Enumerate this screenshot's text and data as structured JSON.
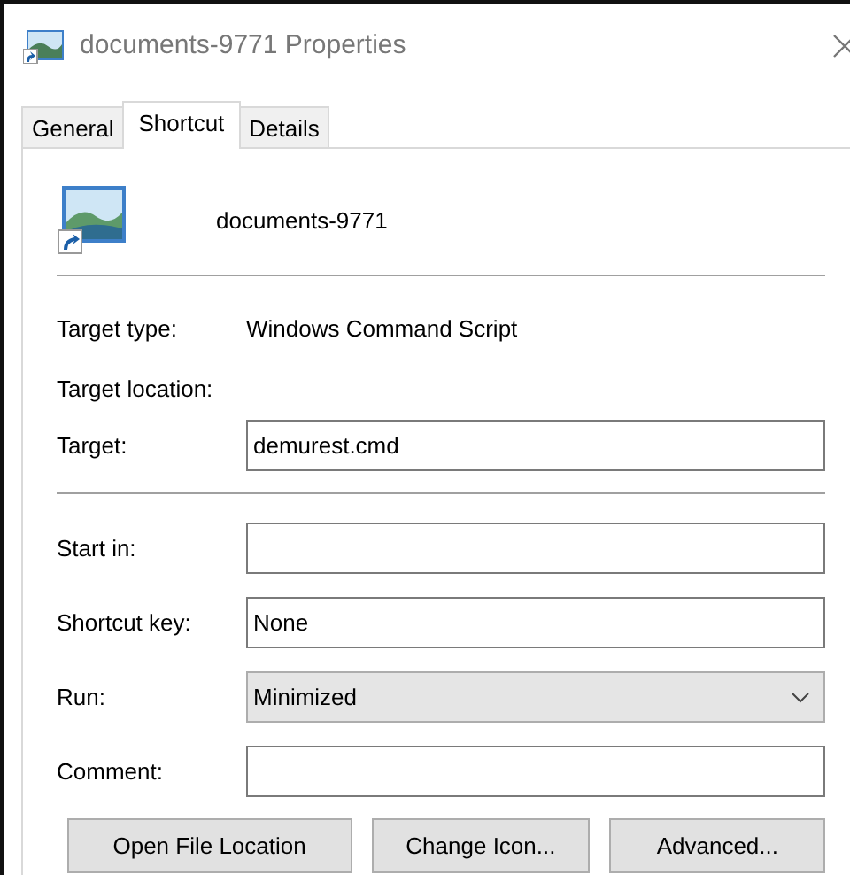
{
  "window": {
    "title": "documents-9771 Properties"
  },
  "tabs": [
    {
      "label": "General",
      "selected": false
    },
    {
      "label": "Shortcut",
      "selected": true
    },
    {
      "label": "Details",
      "selected": false
    }
  ],
  "header": {
    "name": "documents-9771"
  },
  "info": [
    {
      "label": "Target type:",
      "value": "Windows Command Script"
    },
    {
      "label": "Target location:"
    }
  ],
  "target": {
    "label": "Target:",
    "value": "demurest.cmd"
  },
  "fields": [
    {
      "kind": "text",
      "label": "Start in:"
    },
    {
      "kind": "text",
      "label": "Shortcut key:",
      "value": "None"
    },
    {
      "kind": "dropdown",
      "label": "Run:",
      "value": "Minimized"
    },
    {
      "kind": "text",
      "label": "Comment:"
    }
  ],
  "buttons": [
    "Open File Location",
    "Change Icon...",
    "Advanced..."
  ]
}
